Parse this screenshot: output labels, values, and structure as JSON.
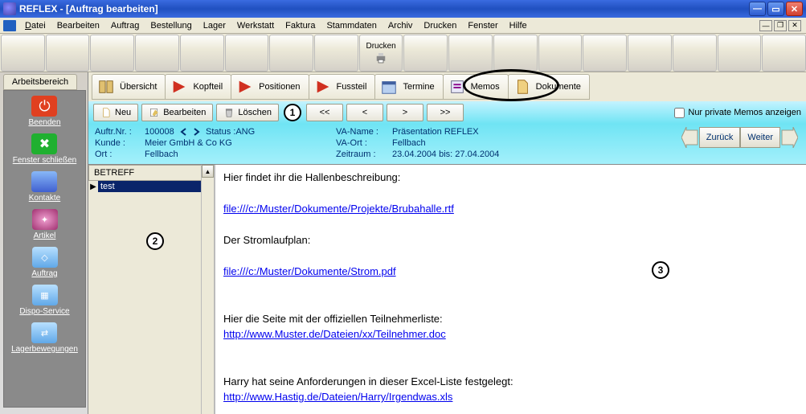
{
  "window": {
    "title": "REFLEX - [Auftrag bearbeiten]"
  },
  "menu": {
    "items": [
      "Datei",
      "Bearbeiten",
      "Auftrag",
      "Bestellung",
      "Lager",
      "Werkstatt",
      "Faktura",
      "Stammdaten",
      "Archiv",
      "Drucken",
      "Fenster",
      "Hilfe"
    ]
  },
  "bigtoolbar": {
    "drucken": "Drucken"
  },
  "sidebar": {
    "tab": "Arbeitsbereich",
    "items": [
      {
        "label": "Beenden",
        "icon": "power-icon",
        "color": "#e04020"
      },
      {
        "label": "Fenster schließen",
        "icon": "window-close-icon",
        "color": "#20b030"
      },
      {
        "label": "Kontakte",
        "icon": "contacts-icon",
        "color": "#4060d0"
      },
      {
        "label": "Artikel",
        "icon": "artikel-icon",
        "color": "#d060a0"
      },
      {
        "label": "Auftrag",
        "icon": "auftrag-icon",
        "color": "#50a0e0"
      },
      {
        "label": "Dispo-Service",
        "icon": "dispo-icon",
        "color": "#50a0e0"
      },
      {
        "label": "Lagerbewegungen",
        "icon": "lager-icon",
        "color": "#50a0e0"
      }
    ]
  },
  "tabs": [
    {
      "label": "Übersicht",
      "icon": "book-icon"
    },
    {
      "label": "Kopfteil",
      "icon": "arrow-red-icon"
    },
    {
      "label": "Positionen",
      "icon": "arrow-red-icon"
    },
    {
      "label": "Fussteil",
      "icon": "arrow-red-icon"
    },
    {
      "label": "Termine",
      "icon": "calendar-icon"
    },
    {
      "label": "Memos",
      "icon": "memo-icon"
    },
    {
      "label": "Dokumente",
      "icon": "doc-icon"
    }
  ],
  "actions": {
    "neu": "Neu",
    "bearbeiten": "Bearbeiten",
    "loeschen": "Löschen",
    "first": "<<",
    "prev": "<",
    "next": ">",
    "last": ">>",
    "privat_memos": "Nur private Memos anzeigen",
    "zurueck": "Zurück",
    "weiter": "Weiter"
  },
  "info": {
    "auftrnr_lbl": "Auftr.Nr. :",
    "auftrnr": "100008",
    "status_lbl": "Status",
    "status": ":ANG",
    "kunde_lbl": "Kunde :",
    "kunde": "Meier GmbH & Co KG",
    "ort_lbl": "Ort :",
    "ort": "Fellbach",
    "vaname_lbl": "VA-Name :",
    "vaname": "Präsentation REFLEX",
    "vaort_lbl": "VA-Ort :",
    "vaort": "Fellbach",
    "zeitraum_lbl": "Zeitraum :",
    "zeitraum": "23.04.2004   bis:  27.04.2004"
  },
  "memo": {
    "col_header": "BETREFF",
    "selected": "test",
    "body": {
      "l1": "Hier findet ihr die Hallenbeschreibung:",
      "a1": "file:///c:/Muster/Dokumente/Projekte/Brubahalle.rtf",
      "l2": "Der Stromlaufplan:",
      "a2": "file:///c:/Muster/Dokumente/Strom.pdf",
      "l3": "Hier die Seite mit der offiziellen Teilnehmerliste:",
      "a3": "http://www.Muster.de/Dateien/xx/Teilnehmer.doc",
      "l4": "Harry hat seine Anforderungen in dieser Excel-Liste festgelegt:",
      "a4": "http://www.Hastig.de/Dateien/Harry/Irgendwas.xls"
    }
  },
  "callouts": {
    "n1": "1",
    "n2": "2",
    "n3": "3"
  }
}
